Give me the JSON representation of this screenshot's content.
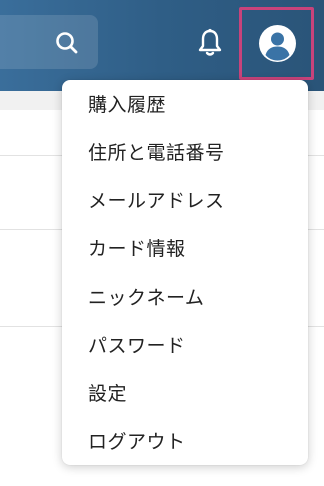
{
  "header": {
    "search_icon": "search-icon",
    "notification_icon": "bell-icon",
    "account_icon": "user-avatar-icon",
    "colors": {
      "background": "#2f5e86",
      "highlight_border": "#c8437b"
    }
  },
  "account_menu": {
    "items": [
      {
        "label": "購入履歴"
      },
      {
        "label": "住所と電話番号"
      },
      {
        "label": "メールアドレス"
      },
      {
        "label": "カード情報"
      },
      {
        "label": "ニックネーム"
      },
      {
        "label": "パスワード"
      },
      {
        "label": "設定"
      },
      {
        "label": "ログアウト"
      }
    ]
  }
}
